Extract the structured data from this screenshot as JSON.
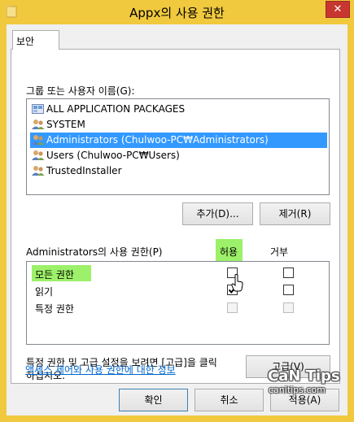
{
  "window": {
    "title": "Appx의 사용 권한",
    "close_glyph": "✕"
  },
  "tabs": [
    {
      "label": "보안"
    }
  ],
  "groups": {
    "label": "그룹 또는 사용자 이름(G):",
    "items": [
      {
        "label": "ALL APPLICATION PACKAGES",
        "icon": "package-group-icon",
        "selected": false
      },
      {
        "label": "SYSTEM",
        "icon": "users-icon",
        "selected": false
      },
      {
        "label": "Administrators (Chulwoo-PC₩Administrators)",
        "icon": "users-icon",
        "selected": true
      },
      {
        "label": "Users (Chulwoo-PC₩Users)",
        "icon": "users-icon",
        "selected": false
      },
      {
        "label": "TrustedInstaller",
        "icon": "users-icon",
        "selected": false
      }
    ],
    "add_label": "추가(D)...",
    "remove_label": "제거(R)"
  },
  "permissions": {
    "label": "Administrators의 사용 권한(P)",
    "allow_header": "허용",
    "deny_header": "거부",
    "rows": [
      {
        "label": "모든 권한",
        "allow": false,
        "deny": false,
        "enabled": true
      },
      {
        "label": "읽기",
        "allow": true,
        "deny": false,
        "enabled": true
      },
      {
        "label": "특정 권한",
        "allow": false,
        "deny": false,
        "enabled": false
      }
    ]
  },
  "advanced": {
    "text_line1": "특정 권한 및 고급 설정을 보려면 [고급]을 클릭",
    "text_line2": "하십시오.",
    "button_label": "고급(V)"
  },
  "link": {
    "label": "액세스 제어와 사용 권한에 대한 정보"
  },
  "footer": {
    "ok_label": "확인",
    "cancel_label": "취소",
    "apply_label": "적용(A)"
  },
  "watermark": {
    "title": "CaN Tips",
    "sub": "canitips.com"
  },
  "colors": {
    "selection": "#3399ff",
    "highlight": "#9df069",
    "titlebar": "#f0c93e",
    "close": "#c7372f",
    "link": "#0066cc"
  }
}
